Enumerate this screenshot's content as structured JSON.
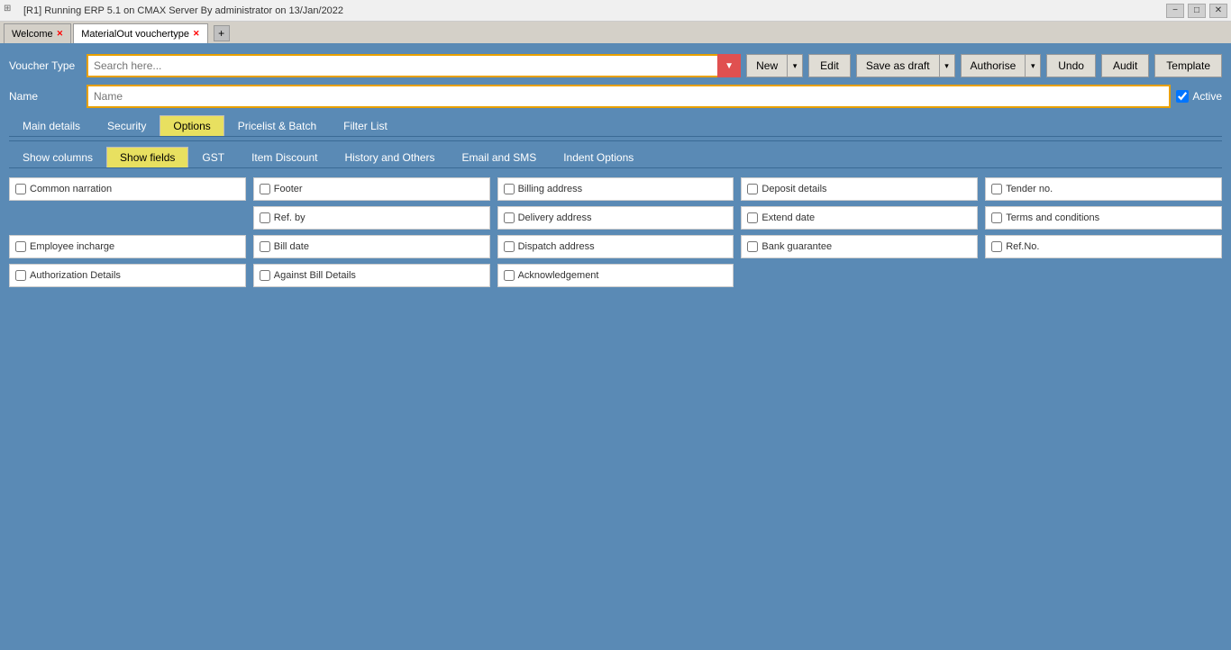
{
  "titleBar": {
    "title": "[R1] Running ERP 5.1 on CMAX Server By administrator on 13/Jan/2022",
    "minimize": "−",
    "maximize": "□",
    "close": "✕"
  },
  "tabs": [
    {
      "id": "welcome",
      "label": "Welcome",
      "closable": true
    },
    {
      "id": "materialout",
      "label": "MaterialOut vouchertype",
      "closable": true,
      "active": true
    }
  ],
  "tabAdd": "+",
  "toolbar": {
    "voucherTypeLabel": "Voucher Type",
    "searchPlaceholder": "Search here...",
    "newLabel": "New",
    "editLabel": "Edit",
    "saveAsDraftLabel": "Save as draft",
    "authoriseLabel": "Authorise",
    "undoLabel": "Undo",
    "auditLabel": "Audit",
    "templateLabel": "Template"
  },
  "nameRow": {
    "label": "Name",
    "placeholder": "Name",
    "activeLabel": "Active"
  },
  "mainTabs": [
    {
      "id": "main-details",
      "label": "Main details",
      "active": false
    },
    {
      "id": "security",
      "label": "Security",
      "active": false
    },
    {
      "id": "options",
      "label": "Options",
      "active": true
    },
    {
      "id": "pricelist-batch",
      "label": "Pricelist & Batch",
      "active": false
    },
    {
      "id": "filter-list",
      "label": "Filter List",
      "active": false
    }
  ],
  "subTabs": [
    {
      "id": "show-columns",
      "label": "Show columns",
      "active": false
    },
    {
      "id": "show-fields",
      "label": "Show fields",
      "active": true
    },
    {
      "id": "gst",
      "label": "GST",
      "active": false
    },
    {
      "id": "item-discount",
      "label": "Item Discount",
      "active": false
    },
    {
      "id": "history-others",
      "label": "History and Others",
      "active": false
    },
    {
      "id": "email-sms",
      "label": "Email and SMS",
      "active": false
    },
    {
      "id": "indent-options",
      "label": "Indent Options",
      "active": false
    }
  ],
  "fields": [
    [
      {
        "id": "common-narration",
        "label": "Common narration",
        "checked": false
      },
      {
        "id": "footer",
        "label": "Footer",
        "checked": false
      },
      {
        "id": "billing-address",
        "label": "Billing address",
        "checked": false
      },
      {
        "id": "deposit-details",
        "label": "Deposit details",
        "checked": false
      },
      {
        "id": "tender-no",
        "label": "Tender no.",
        "checked": false
      }
    ],
    [
      {
        "id": "empty1",
        "label": "",
        "empty": true
      },
      {
        "id": "ref-by",
        "label": "Ref. by",
        "checked": false
      },
      {
        "id": "delivery-address",
        "label": "Delivery address",
        "checked": false
      },
      {
        "id": "extend-date",
        "label": "Extend date",
        "checked": false
      },
      {
        "id": "terms-conditions",
        "label": "Terms and conditions",
        "checked": false
      }
    ],
    [
      {
        "id": "employee-incharge",
        "label": "Employee incharge",
        "checked": false
      },
      {
        "id": "bill-date",
        "label": "Bill date",
        "checked": false
      },
      {
        "id": "dispatch-address",
        "label": "Dispatch address",
        "checked": false
      },
      {
        "id": "bank-guarantee",
        "label": "Bank guarantee",
        "checked": false
      },
      {
        "id": "ref-no",
        "label": "Ref.No.",
        "checked": false
      }
    ],
    [
      {
        "id": "authorization-details",
        "label": "Authorization Details",
        "checked": false
      },
      {
        "id": "against-bill-details",
        "label": "Against Bill Details",
        "checked": false
      },
      {
        "id": "acknowledgement",
        "label": "Acknowledgement",
        "checked": false
      },
      {
        "id": "empty2",
        "label": "",
        "empty": true
      },
      {
        "id": "empty3",
        "label": "",
        "empty": true
      }
    ]
  ]
}
